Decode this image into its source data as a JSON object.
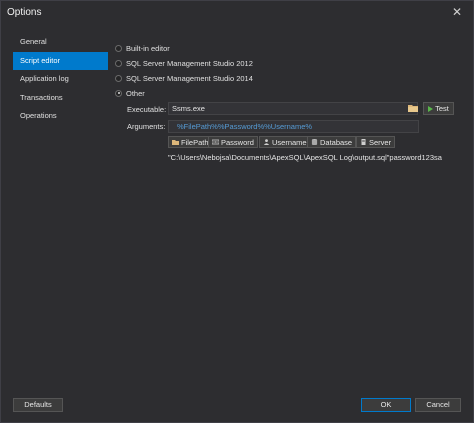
{
  "window": {
    "title": "Options",
    "close_glyph": "✕"
  },
  "sidebar": {
    "items": [
      {
        "label": "General"
      },
      {
        "label": "Script editor"
      },
      {
        "label": "Application log"
      },
      {
        "label": "Transactions"
      },
      {
        "label": "Operations"
      }
    ],
    "selected": "Script editor"
  },
  "editor": {
    "options": [
      {
        "label": "Built-in editor",
        "checked": false
      },
      {
        "label": "SQL Server Management Studio 2012",
        "checked": false
      },
      {
        "label": "SQL Server Management Studio 2014",
        "checked": false
      },
      {
        "label": "Other",
        "checked": true
      }
    ],
    "executable_label": "Executable:",
    "executable_value": "Ssms.exe",
    "test_label": "Test",
    "arguments_label": "Arguments:",
    "arguments_value": "%FilePath%%Password%%Username%",
    "chips": [
      {
        "label": "FilePath",
        "icon": "folder-icon"
      },
      {
        "label": "Password",
        "icon": "password-icon"
      },
      {
        "label": "Username",
        "icon": "user-icon"
      },
      {
        "label": "Database",
        "icon": "database-icon"
      },
      {
        "label": "Server",
        "icon": "server-icon"
      }
    ],
    "preview": "\"C:\\Users\\Nebojsa\\Documents\\ApexSQL\\ApexSQL Log\\output.sql\"password123sa"
  },
  "footer": {
    "defaults_label": "Defaults",
    "ok_label": "OK",
    "cancel_label": "Cancel"
  },
  "colors": {
    "accent": "#007acc",
    "background": "#2d2d30",
    "argument_text": "#569cd6",
    "test_icon": "#59b54b"
  }
}
